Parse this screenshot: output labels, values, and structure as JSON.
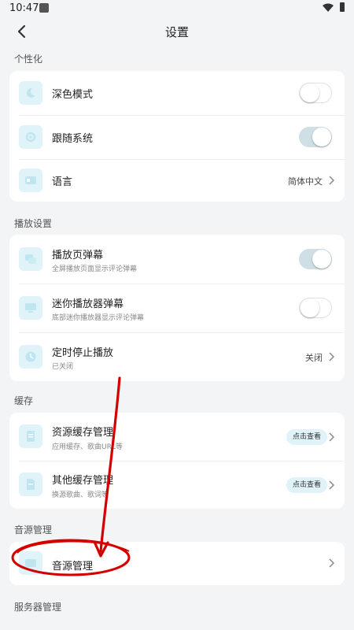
{
  "status_bar": {
    "time": "10:47"
  },
  "header": {
    "title": "设置"
  },
  "sections": {
    "personalization": {
      "title": "个性化",
      "dark_mode": {
        "label": "深色模式",
        "enabled": false
      },
      "follow_system": {
        "label": "跟随系统",
        "enabled": true
      },
      "language": {
        "label": "语言",
        "value": "简体中文"
      }
    },
    "playback": {
      "title": "播放设置",
      "player_danmaku": {
        "label": "播放页弹幕",
        "subtitle": "全屏播放页面显示评论弹幕",
        "enabled": true
      },
      "mini_danmaku": {
        "label": "迷你播放器弹幕",
        "subtitle": "底部迷你播放器显示评论弹幕",
        "enabled": false
      },
      "sleep_timer": {
        "label": "定时停止播放",
        "subtitle": "已关闭",
        "value": "关闭"
      }
    },
    "cache": {
      "title": "缓存",
      "resource_cache": {
        "label": "资源缓存管理",
        "subtitle": "应用缓存、歌曲URL等",
        "action": "点击查看"
      },
      "other_cache": {
        "label": "其他缓存管理",
        "subtitle": "换源歌曲、歌词等",
        "action": "点击查看"
      }
    },
    "source": {
      "title": "音源管理",
      "source_manage": {
        "label": "音源管理"
      }
    },
    "server": {
      "title": "服务器管理"
    }
  },
  "colors": {
    "accent_light": "#dff3f8",
    "annotation": "#d40000",
    "toggle_on": "#cfdfe6"
  },
  "icons": [
    "moon-icon",
    "settings-icon",
    "language-icon",
    "danmaku-icon",
    "monitor-icon",
    "timer-icon",
    "document-icon",
    "file-icon",
    "music-source-icon",
    "chevron-right-icon",
    "back-arrow-icon"
  ]
}
